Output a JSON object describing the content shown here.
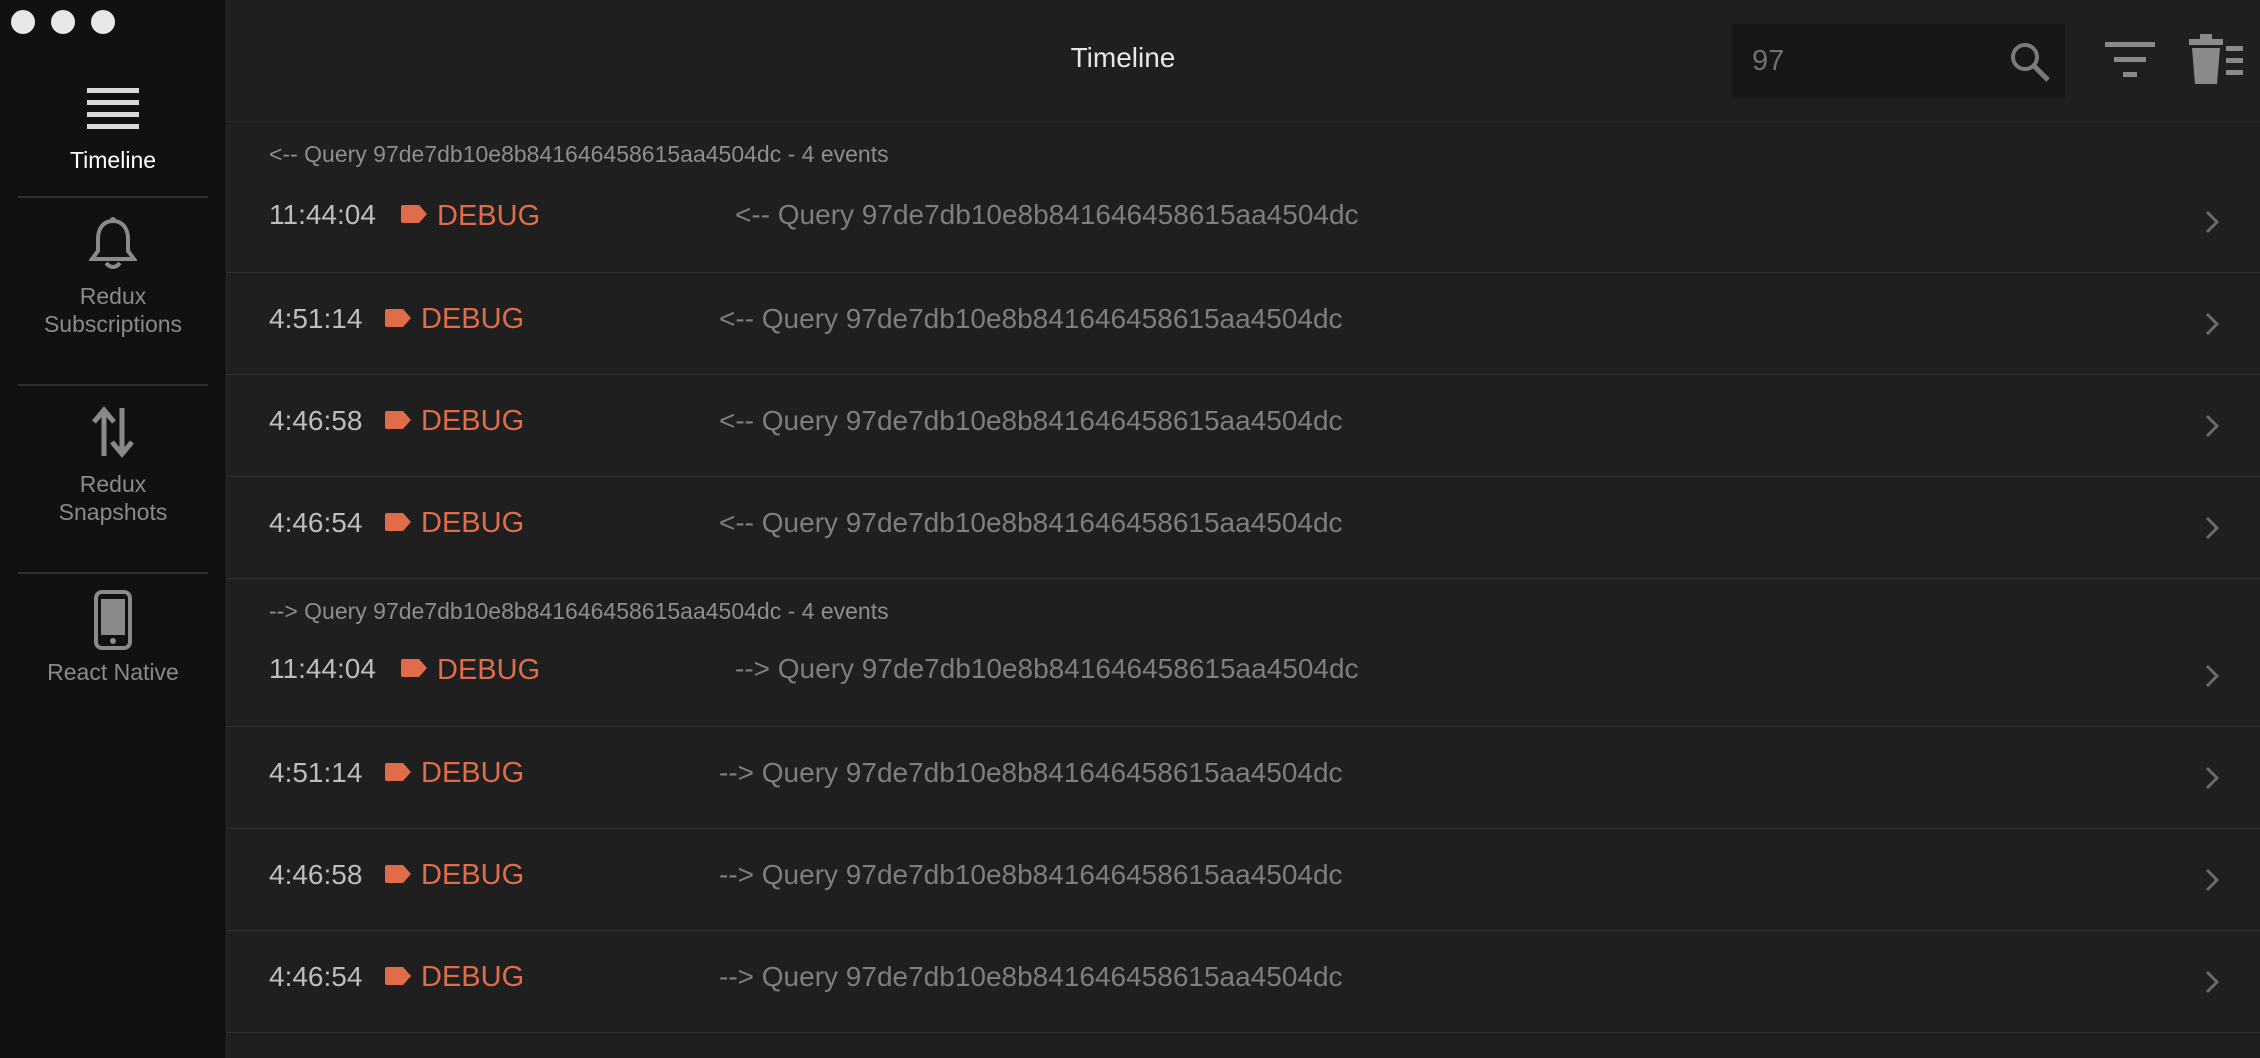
{
  "window": {
    "title": "Timeline"
  },
  "sidebar": {
    "items": [
      {
        "label": "Timeline",
        "icon": "list-icon",
        "active": true
      },
      {
        "label": "Redux\nSubscriptions",
        "icon": "bell-icon",
        "active": false
      },
      {
        "label": "Redux\nSnapshots",
        "icon": "up-down-arrows-icon",
        "active": false
      },
      {
        "label": "React Native",
        "icon": "phone-icon",
        "active": false
      }
    ]
  },
  "header": {
    "title": "Timeline",
    "search_value": "97",
    "filter_icon": "filter-icon",
    "trash_icon": "trash-icon"
  },
  "colors": {
    "accent": "#e06c4a",
    "sidebar_bg": "#111111",
    "main_bg": "#1f1f1f"
  },
  "groups": [
    {
      "title": "<-- Query 97de7db10e8b841646458615aa4504dc - 4 events",
      "rows": [
        {
          "time": "11:44:04",
          "level": "DEBUG",
          "message": "<-- Query 97de7db10e8b841646458615aa4504dc"
        },
        {
          "time": "4:51:14",
          "level": "DEBUG",
          "message": "<-- Query 97de7db10e8b841646458615aa4504dc"
        },
        {
          "time": "4:46:58",
          "level": "DEBUG",
          "message": "<-- Query 97de7db10e8b841646458615aa4504dc"
        },
        {
          "time": "4:46:54",
          "level": "DEBUG",
          "message": "<-- Query 97de7db10e8b841646458615aa4504dc"
        }
      ]
    },
    {
      "title": "--> Query 97de7db10e8b841646458615aa4504dc - 4 events",
      "rows": [
        {
          "time": "11:44:04",
          "level": "DEBUG",
          "message": "--> Query 97de7db10e8b841646458615aa4504dc"
        },
        {
          "time": "4:51:14",
          "level": "DEBUG",
          "message": "--> Query 97de7db10e8b841646458615aa4504dc"
        },
        {
          "time": "4:46:58",
          "level": "DEBUG",
          "message": "--> Query 97de7db10e8b841646458615aa4504dc"
        },
        {
          "time": "4:46:54",
          "level": "DEBUG",
          "message": "--> Query 97de7db10e8b841646458615aa4504dc"
        }
      ]
    }
  ]
}
